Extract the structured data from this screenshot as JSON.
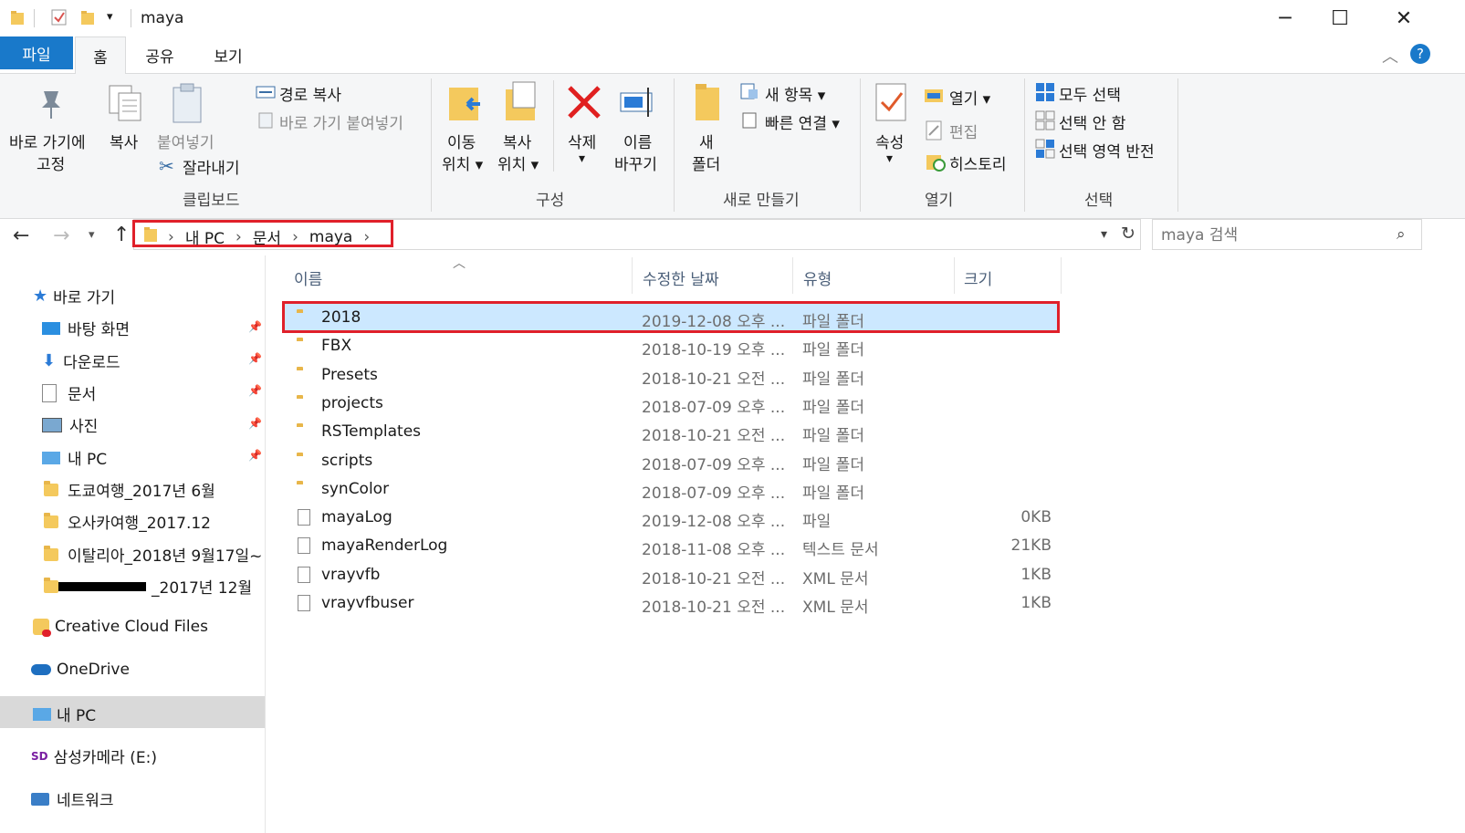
{
  "window": {
    "title": "maya",
    "controls": {
      "minimize": "─",
      "maximize": "☐",
      "close": "✕"
    }
  },
  "tabs": [
    {
      "label": "파일",
      "active_style": "file-tab"
    },
    {
      "label": "홈",
      "selected": true
    },
    {
      "label": "공유"
    },
    {
      "label": "보기"
    }
  ],
  "ribbon": {
    "clipboard": {
      "pin_label_1": "바로 가기에",
      "pin_label_2": "고정",
      "copy": "복사",
      "paste": "붙여넣기",
      "copy_path": "경로 복사",
      "paste_shortcut": "바로 가기 붙여넣기",
      "cut": "잘라내기",
      "group": "클립보드"
    },
    "organize": {
      "move_1": "이동",
      "move_2": "위치",
      "copy_1": "복사",
      "copy_2": "위치",
      "delete": "삭제",
      "rename_1": "이름",
      "rename_2": "바꾸기",
      "group": "구성"
    },
    "new": {
      "folder_1": "새",
      "folder_2": "폴더",
      "new_item": "새 항목",
      "easy_access": "빠른 연결",
      "group": "새로 만들기"
    },
    "open": {
      "properties": "속성",
      "open": "열기",
      "edit": "편집",
      "history": "히스토리",
      "group": "열기"
    },
    "select": {
      "select_all": "모두 선택",
      "select_none": "선택 안 함",
      "invert": "선택 영역 반전",
      "group": "선택"
    }
  },
  "address": {
    "crumbs": [
      "내 PC",
      "문서",
      "maya"
    ],
    "search_placeholder": "maya 검색"
  },
  "sidebar": {
    "quick_access": "바로 가기",
    "items": [
      {
        "label": "바탕 화면",
        "pinned": true
      },
      {
        "label": "다운로드",
        "pinned": true
      },
      {
        "label": "문서",
        "pinned": true
      },
      {
        "label": "사진",
        "pinned": true
      },
      {
        "label": "내 PC",
        "pinned": true
      },
      {
        "label": "도쿄여행_2017년 6월"
      },
      {
        "label": "오사카여행_2017.12"
      },
      {
        "label": "이탈리아_2018년 9월17일~"
      },
      {
        "label": "_2017년 12월"
      }
    ],
    "creative_cloud": "Creative Cloud Files",
    "onedrive": "OneDrive",
    "this_pc": "내 PC",
    "drive": "삼성카메라 (E:)",
    "network": "네트워크"
  },
  "columns": {
    "name": "이름",
    "date": "수정한 날짜",
    "type": "유형",
    "size": "크기"
  },
  "files": [
    {
      "name": "2018",
      "date": "2019-12-08 오후 ...",
      "type": "파일 폴더",
      "size": "",
      "kind": "folder"
    },
    {
      "name": "FBX",
      "date": "2018-10-19 오후 ...",
      "type": "파일 폴더",
      "size": "",
      "kind": "folder"
    },
    {
      "name": "Presets",
      "date": "2018-10-21 오전 ...",
      "type": "파일 폴더",
      "size": "",
      "kind": "folder"
    },
    {
      "name": "projects",
      "date": "2018-07-09 오후 ...",
      "type": "파일 폴더",
      "size": "",
      "kind": "folder"
    },
    {
      "name": "RSTemplates",
      "date": "2018-10-21 오전 ...",
      "type": "파일 폴더",
      "size": "",
      "kind": "folder"
    },
    {
      "name": "scripts",
      "date": "2018-07-09 오후 ...",
      "type": "파일 폴더",
      "size": "",
      "kind": "folder"
    },
    {
      "name": "synColor",
      "date": "2018-07-09 오후 ...",
      "type": "파일 폴더",
      "size": "",
      "kind": "folder"
    },
    {
      "name": "mayaLog",
      "date": "2019-12-08 오후 ...",
      "type": "파일",
      "size": "0KB",
      "kind": "file"
    },
    {
      "name": "mayaRenderLog",
      "date": "2018-11-08 오후 ...",
      "type": "텍스트 문서",
      "size": "21KB",
      "kind": "file"
    },
    {
      "name": "vrayvfb",
      "date": "2018-10-21 오전 ...",
      "type": "XML 문서",
      "size": "1KB",
      "kind": "file"
    },
    {
      "name": "vrayvfbuser",
      "date": "2018-10-21 오전 ...",
      "type": "XML 문서",
      "size": "1KB",
      "kind": "file"
    }
  ],
  "colors": {
    "accent": "#1979ca",
    "highlight_box": "#e0202a",
    "selection": "#cce8ff"
  }
}
